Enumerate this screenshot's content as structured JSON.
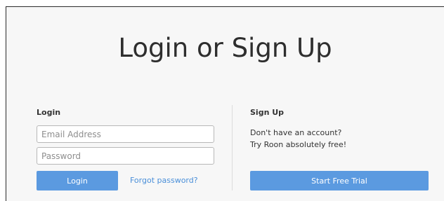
{
  "page": {
    "title": "Login or Sign Up"
  },
  "login": {
    "heading": "Login",
    "email_placeholder": "Email Address",
    "password_placeholder": "Password",
    "login_button": "Login",
    "forgot_link": "Forgot password?"
  },
  "signup": {
    "heading": "Sign Up",
    "line1": "Don't have an account?",
    "line2": "Try Roon absolutely free!",
    "trial_button": "Start Free Trial"
  },
  "colors": {
    "accent": "#5b9ae0",
    "link": "#4a8fd9",
    "background": "#f7f7f7"
  }
}
